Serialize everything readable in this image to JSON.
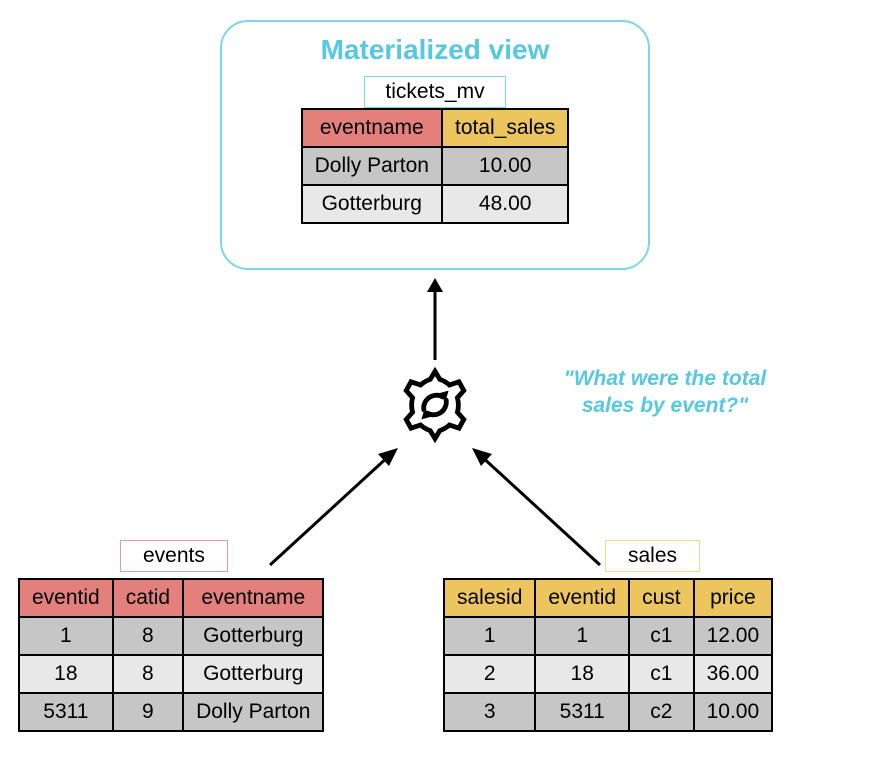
{
  "mv": {
    "title": "Materialized view",
    "label": "tickets_mv",
    "headers": {
      "col1": "eventname",
      "col2": "total_sales"
    },
    "rows": [
      {
        "eventname": "Dolly Parton",
        "total_sales": "10.00"
      },
      {
        "eventname": "Gotterburg",
        "total_sales": "48.00"
      }
    ]
  },
  "query": "\"What were the total sales by event?\"",
  "events": {
    "label": "events",
    "headers": {
      "col1": "eventid",
      "col2": "catid",
      "col3": "eventname"
    },
    "rows": [
      {
        "eventid": "1",
        "catid": "8",
        "eventname": "Gotterburg"
      },
      {
        "eventid": "18",
        "catid": "8",
        "eventname": "Gotterburg"
      },
      {
        "eventid": "5311",
        "catid": "9",
        "eventname": "Dolly Parton"
      }
    ]
  },
  "sales": {
    "label": "sales",
    "headers": {
      "col1": "salesid",
      "col2": "eventid",
      "col3": "cust",
      "col4": "price"
    },
    "rows": [
      {
        "salesid": "1",
        "eventid": "1",
        "cust": "c1",
        "price": "12.00"
      },
      {
        "salesid": "2",
        "eventid": "18",
        "cust": "c1",
        "price": "36.00"
      },
      {
        "salesid": "3",
        "eventid": "5311",
        "cust": "c2",
        "price": "10.00"
      }
    ]
  }
}
